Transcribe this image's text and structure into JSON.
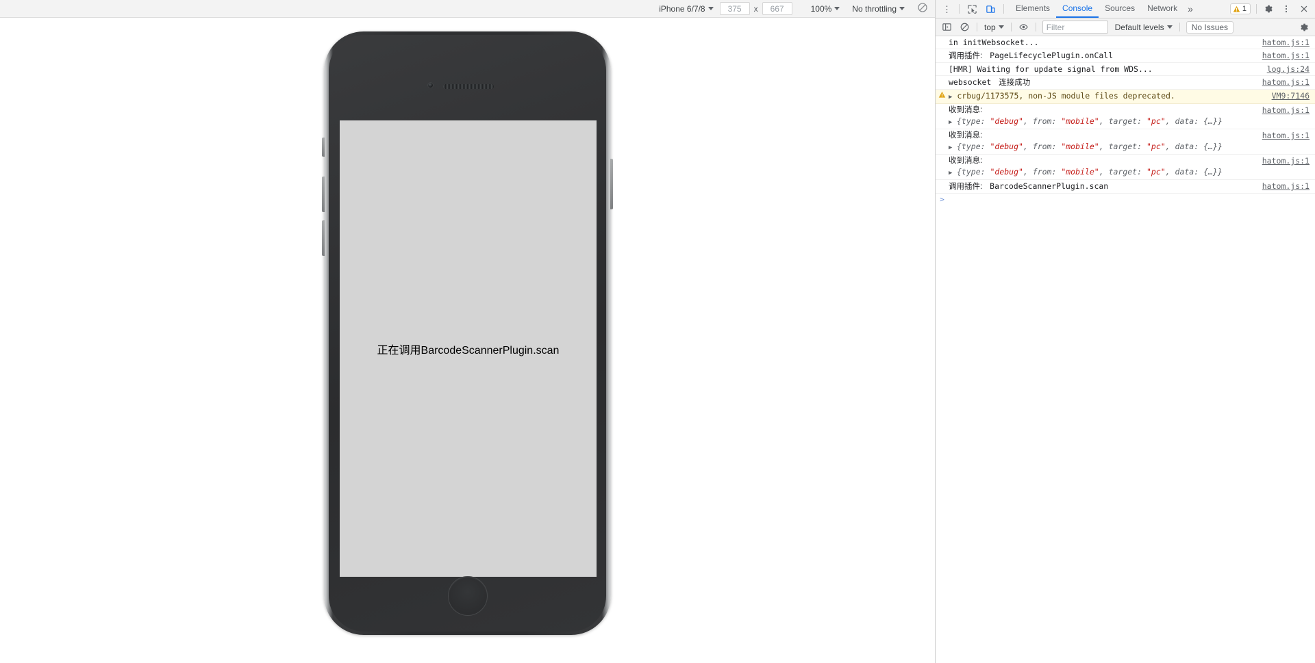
{
  "device_toolbar": {
    "device_name": "iPhone 6/7/8",
    "width": "375",
    "height": "667",
    "x_label": "x",
    "zoom": "100%",
    "throttling": "No throttling",
    "rotate_icon": "rotate-icon"
  },
  "phone": {
    "screen_text": "正在调用BarcodeScannerPlugin.scan",
    "screen_bg": "#d4d4d4"
  },
  "devtools": {
    "inspect_icon": "inspect-element-icon",
    "device_toggle_icon": "device-toolbar-icon",
    "tabs": [
      {
        "label": "Elements",
        "active": false
      },
      {
        "label": "Console",
        "active": true
      },
      {
        "label": "Sources",
        "active": false
      },
      {
        "label": "Network",
        "active": false
      }
    ],
    "more_tabs_label": "»",
    "warning_count": "1",
    "settings_icon": "gear-icon",
    "menu_icon": "kebab-menu-icon",
    "close_icon": "close-icon",
    "console_toolbar": {
      "sidebar_icon": "console-sidebar-icon",
      "clear_icon": "clear-console-icon",
      "context": "top",
      "eye_icon": "live-expression-icon",
      "filter_placeholder": "Filter",
      "filter_value": "",
      "levels": "Default levels",
      "issues": "No Issues",
      "settings_icon": "gear-icon"
    },
    "messages": [
      {
        "level": "log",
        "text": "in initWebsocket...",
        "source": "hatom.js:1",
        "object": null,
        "label": null
      },
      {
        "level": "log",
        "label": "调用插件:",
        "text": "PageLifecyclePlugin.onCall",
        "source": "hatom.js:1",
        "object": null
      },
      {
        "level": "log",
        "text": "[HMR] Waiting for update signal from WDS...",
        "source": "log.js:24",
        "object": null,
        "label": null
      },
      {
        "level": "log",
        "label": "websocket",
        "text": "连接成功",
        "source": "hatom.js:1",
        "object": null,
        "cjk_text": true
      },
      {
        "level": "warning",
        "text": "crbug/1173575, non-JS module files deprecated.",
        "source": "VM9:7146",
        "object": null,
        "label": null,
        "expandable": true
      },
      {
        "level": "log",
        "label": "收到消息:",
        "text": "",
        "source": "hatom.js:1",
        "object": {
          "prefix": "{type: ",
          "v1": "\"debug\"",
          "k2": ", from: ",
          "v2": "\"mobile\"",
          "k3": ", target: ",
          "v3": "\"pc\"",
          "k4": ", data: ",
          "suffix": "{…}}"
        }
      },
      {
        "level": "log",
        "label": "收到消息:",
        "text": "",
        "source": "hatom.js:1",
        "object": {
          "prefix": "{type: ",
          "v1": "\"debug\"",
          "k2": ", from: ",
          "v2": "\"mobile\"",
          "k3": ", target: ",
          "v3": "\"pc\"",
          "k4": ", data: ",
          "suffix": "{…}}"
        }
      },
      {
        "level": "log",
        "label": "收到消息:",
        "text": "",
        "source": "hatom.js:1",
        "object": {
          "prefix": "{type: ",
          "v1": "\"debug\"",
          "k2": ", from: ",
          "v2": "\"mobile\"",
          "k3": ", target: ",
          "v3": "\"pc\"",
          "k4": ", data: ",
          "suffix": "{…}}"
        }
      },
      {
        "level": "log",
        "label": "调用插件:",
        "text": "BarcodeScannerPlugin.scan",
        "source": "hatom.js:1",
        "object": null
      }
    ],
    "prompt_caret": ">"
  },
  "colors": {
    "accent": "#1a73e8",
    "warning_bg": "#fffbe5",
    "warning_icon": "#e0a313",
    "string_red": "#c41a16",
    "link_gray": "#5f6368"
  }
}
